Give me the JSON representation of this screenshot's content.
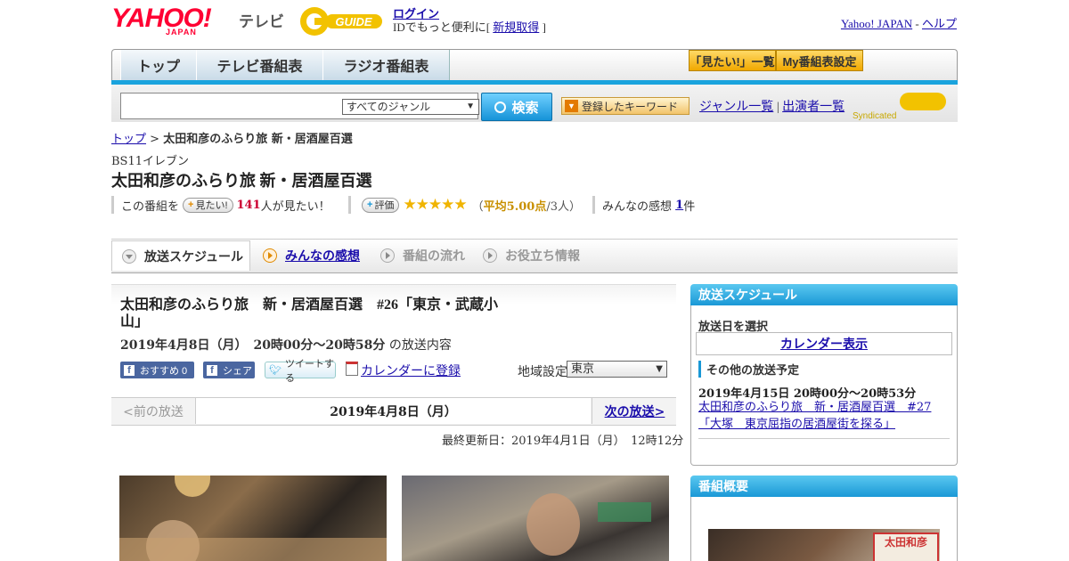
{
  "header": {
    "yahoo_logo": "YAHOO!",
    "yahoo_sub": "JAPAN",
    "tv_label": "テレビ",
    "gguide_logo": "G GUIDE",
    "login_link": "ログイン",
    "login_text_prefix": "IDでもっと便利に[ ",
    "signup_link": "新規取得",
    "login_text_suffix": " ]",
    "yahoo_japan_link": "Yahoo! JAPAN",
    "separator": " - ",
    "help_link": "ヘルプ"
  },
  "nav": {
    "tabs": [
      "トップ",
      "テレビ番組表",
      "ラジオ番組表"
    ],
    "want_list_btn": "「見たい!」一覧",
    "my_schedule_btn": "My番組表設定"
  },
  "search": {
    "input_value": "",
    "genre_selected": "すべてのジャンル",
    "search_btn": "検索",
    "keyword_btn": "登録したキーワード",
    "genre_list_link": "ジャンル一覧",
    "links_separator": " | ",
    "performer_list_link": "出演者一覧",
    "syndicated": "Syndicated"
  },
  "breadcrumb": {
    "top_link": "トップ",
    "separator": " > ",
    "current": "太田和彦のふらり旅 新・居酒屋百選"
  },
  "program": {
    "station": "BS11イレブン",
    "title": "太田和彦のふらり旅 新・居酒屋百選",
    "want_prefix": "この番組を",
    "want_btn": "見たい!",
    "want_count": "141",
    "want_suffix": "人が見たい！",
    "rating_btn": "評価",
    "stars": "★★★★★",
    "rating_open": "（",
    "rating_avg": "平均5.00点",
    "rating_count": "/3人）",
    "impressions_label": "みんなの感想",
    "impressions_count": "1",
    "impressions_suffix": "件"
  },
  "tabs": {
    "schedule": "放送スケジュール",
    "impressions": "みんなの感想",
    "flow": "番組の流れ",
    "info": "お役立ち情報"
  },
  "episode": {
    "title": "太田和彦のふらり旅　新・居酒屋百選　#26「東京・武蔵小山」",
    "date": "2019年4月8日（月）　20時00分～20時58分",
    "date_suffix": "の放送内容",
    "fb_recommend": "おすすめ 0",
    "fb_share": "シェア",
    "tweet": "ツイートする",
    "calendar_register": "カレンダーに登録",
    "region_label": "地域設定",
    "region_value": "東京",
    "prev": "<前の放送",
    "pager_date": "2019年4月8日（月）",
    "next": "次の放送>",
    "updated": "最終更新日：2019年4月1日（月）　12時12分"
  },
  "sidebar": {
    "schedule_head": "放送スケジュール",
    "select_date": "放送日を選択",
    "calendar_btn": "カレンダー表示",
    "other_label": "その他の放送予定",
    "other_date": "2019年4月15日  20時00分～20時53分",
    "other_link": "太田和彦のふらり旅　新・居酒屋百選　#27「大塚　東京屈指の居酒屋街を探る」",
    "overview_head": "番組概要",
    "photo_sign": "太田和彦"
  },
  "colors": {
    "accent_blue": "#1aa3dd",
    "yahoo_red": "#ff0033",
    "star_gold": "#f0b400",
    "want_count_red": "#cc0033"
  }
}
